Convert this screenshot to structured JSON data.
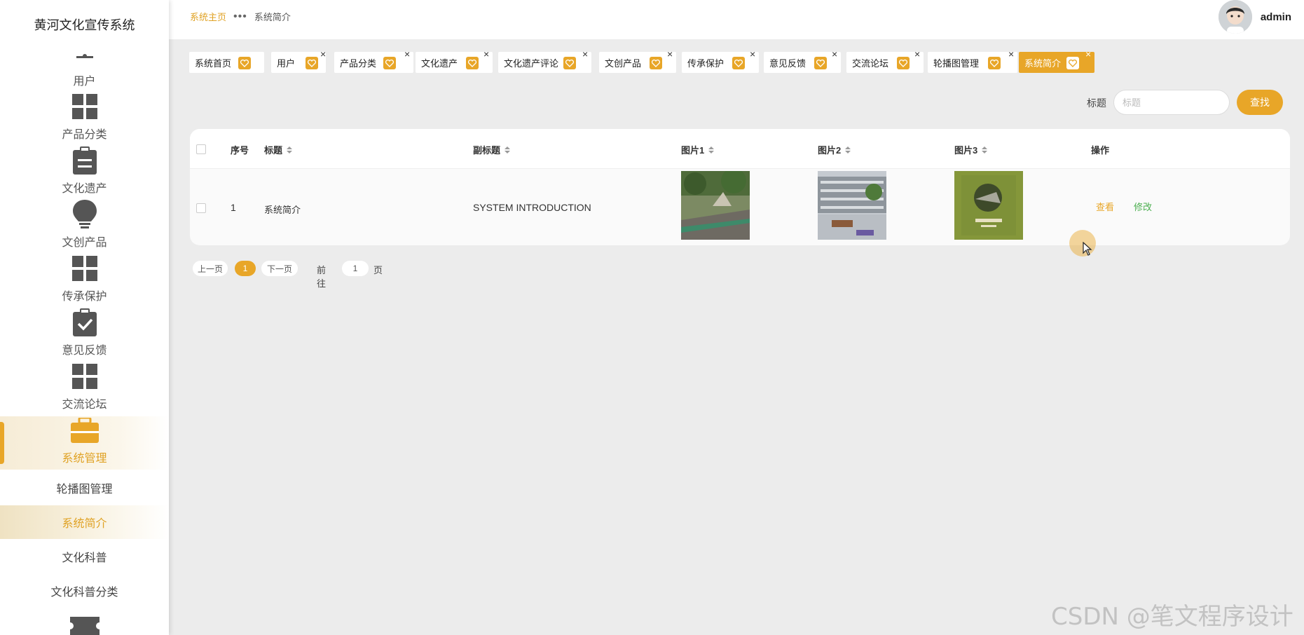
{
  "app": {
    "title": "黄河文化宣传系统"
  },
  "sidebar": {
    "items": [
      {
        "label": "用户",
        "icon": "user-icon"
      },
      {
        "label": "产品分类",
        "icon": "grid-icon"
      },
      {
        "label": "文化遗产",
        "icon": "clipboard-icon"
      },
      {
        "label": "文创产品",
        "icon": "lightbulb-icon"
      },
      {
        "label": "传承保护",
        "icon": "grid-icon"
      },
      {
        "label": "意见反馈",
        "icon": "clipboard-check-icon"
      },
      {
        "label": "交流论坛",
        "icon": "grid-icon"
      },
      {
        "label": "系统管理",
        "icon": "briefcase-icon"
      }
    ],
    "subitems": [
      {
        "label": "轮播图管理"
      },
      {
        "label": "系统简介"
      },
      {
        "label": "文化科普"
      },
      {
        "label": "文化科普分类"
      }
    ]
  },
  "header": {
    "breadcrumb_home": "系统主页",
    "breadcrumb_sep": "•••",
    "breadcrumb_current": "系统简介",
    "username": "admin"
  },
  "tabs": [
    {
      "label": "系统首页"
    },
    {
      "label": "用户"
    },
    {
      "label": "产品分类"
    },
    {
      "label": "文化遗产"
    },
    {
      "label": "文化遗产评论"
    },
    {
      "label": "文创产品"
    },
    {
      "label": "传承保护"
    },
    {
      "label": "意见反馈"
    },
    {
      "label": "交流论坛"
    },
    {
      "label": "轮播图管理"
    },
    {
      "label": "系统简介"
    }
  ],
  "tab_close": "×",
  "search": {
    "label": "标题",
    "placeholder": "标题",
    "button": "查找"
  },
  "table": {
    "columns": [
      "序号",
      "标题",
      "副标题",
      "图片1",
      "图片2",
      "图片3",
      "操作"
    ],
    "rows": [
      {
        "index": "1",
        "title": "系统简介",
        "subtitle": "SYSTEM INTRODUCTION",
        "view": "查看",
        "edit": "修改"
      }
    ]
  },
  "pagination": {
    "prev": "上一页",
    "current": "1",
    "next": "下一页",
    "goto": "前往",
    "page_input": "1",
    "page_unit": "页"
  },
  "watermark": "CSDN @笔文程序设计",
  "colors": {
    "accent": "#e8a628",
    "edit": "#4caf50",
    "background": "#ececec"
  }
}
